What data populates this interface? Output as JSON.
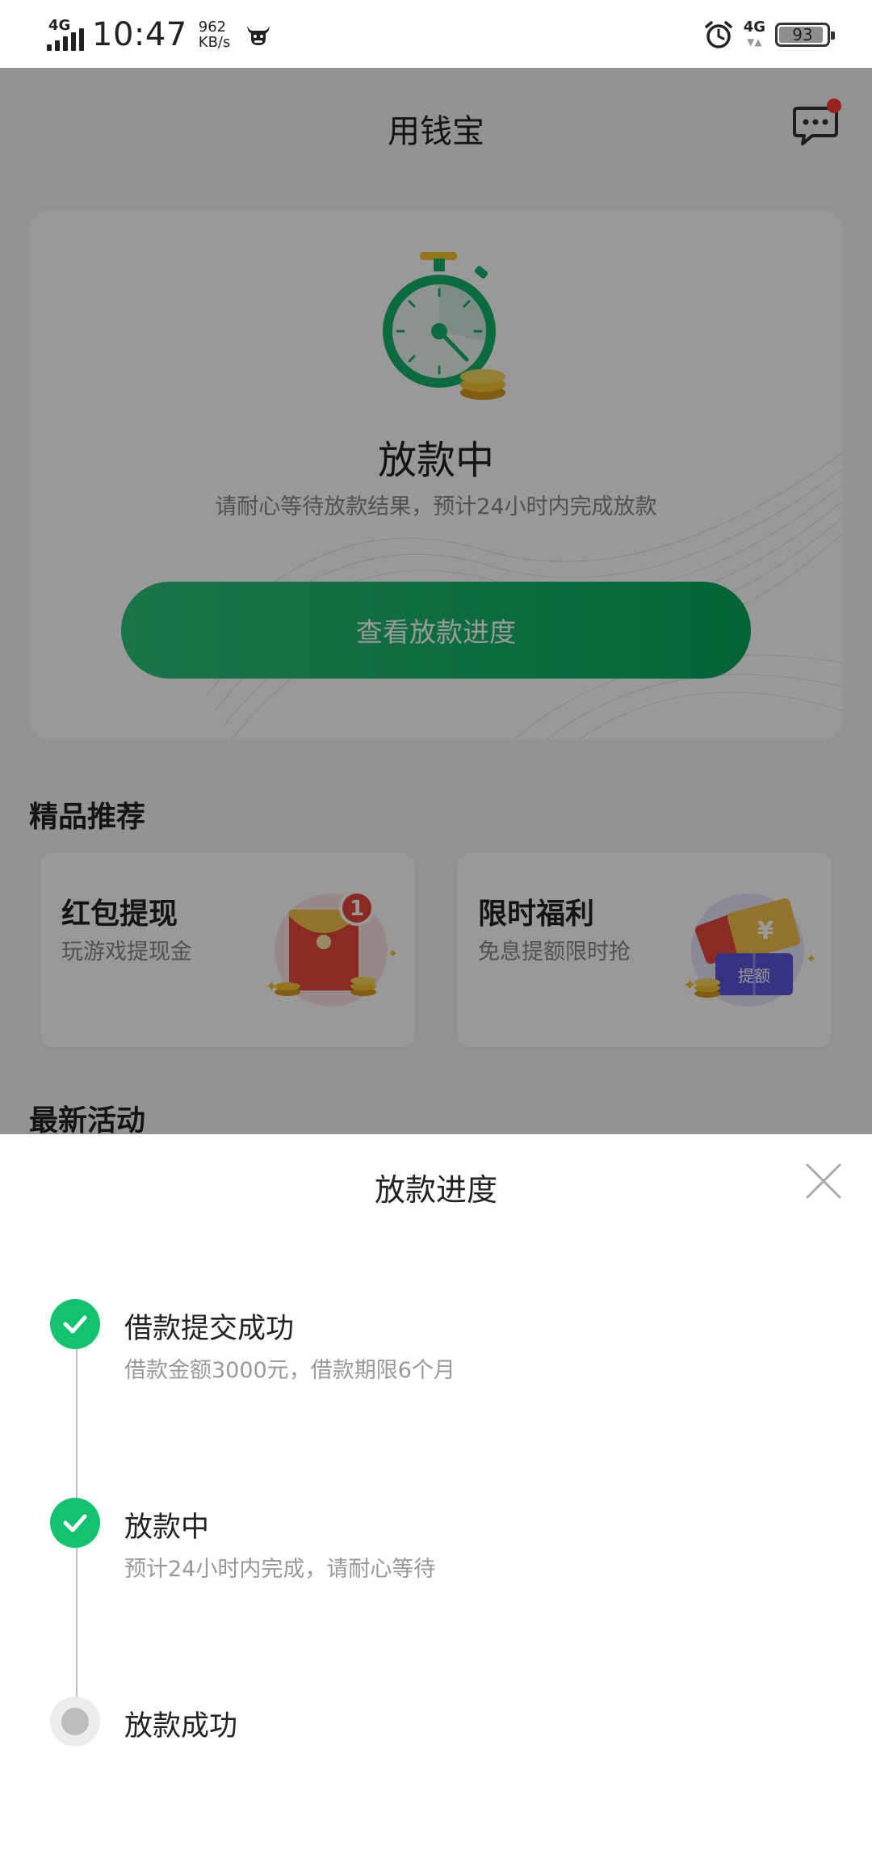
{
  "status_bar": {
    "network_type": "4G",
    "time": "10:47",
    "speed_value": "962",
    "speed_unit": "KB/s",
    "alarm_icon": "alarm-clock-icon",
    "data_network": "4G",
    "battery": "93",
    "battery_level": 0.93
  },
  "app": {
    "title": "用钱宝",
    "message_icon": "chat-bubble-icon",
    "status_card": {
      "title": "放款中",
      "subtitle": "请耐心等待放款结果，预计24小时内完成放款",
      "button_label": "查看放款进度"
    },
    "recommend": {
      "section_title": "精品推荐",
      "items": [
        {
          "title": "红包提现",
          "subtitle": "玩游戏提现金",
          "badge": "1",
          "icon": "red-envelope-icon"
        },
        {
          "title": "限时福利",
          "subtitle": "免息提额限时抢",
          "tag": "提额",
          "icon": "coupon-ticket-icon"
        }
      ]
    },
    "activities": {
      "section_title": "最新活动"
    }
  },
  "sheet": {
    "title": "放款进度",
    "close_icon": "close-icon",
    "steps": [
      {
        "title": "借款提交成功",
        "desc": "借款金额3000元，借款期限6个月",
        "status": "done"
      },
      {
        "title": "放款中",
        "desc": "预计24小时内完成，请耐心等待",
        "status": "done"
      },
      {
        "title": "放款成功",
        "desc": "",
        "status": "pending"
      }
    ]
  },
  "colors": {
    "accent_green": "#13c26e",
    "button_gradient_start": "#2cc47a",
    "button_gradient_end": "#05a85b",
    "notification_dot": "#ff3b30",
    "overlay": "rgba(0,0,0,0.4)"
  }
}
